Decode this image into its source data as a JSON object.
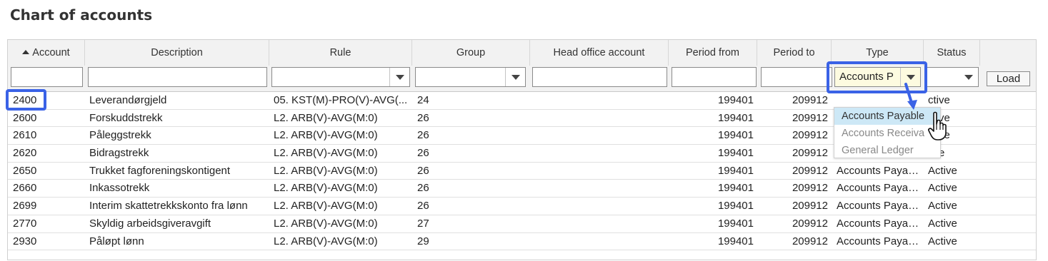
{
  "page": {
    "title": "Chart of accounts"
  },
  "columns": [
    {
      "key": "account",
      "label": "Account",
      "sorted": "asc"
    },
    {
      "key": "description",
      "label": "Description"
    },
    {
      "key": "rule",
      "label": "Rule"
    },
    {
      "key": "group",
      "label": "Group"
    },
    {
      "key": "head_office_account",
      "label": "Head office account"
    },
    {
      "key": "period_from",
      "label": "Period from"
    },
    {
      "key": "period_to",
      "label": "Period to"
    },
    {
      "key": "type",
      "label": "Type"
    },
    {
      "key": "status",
      "label": "Status"
    }
  ],
  "filters": {
    "account": "",
    "description": "",
    "rule": "",
    "group": "",
    "head_office_account": "",
    "period_from": "",
    "period_to": "",
    "type": "Accounts P",
    "status": "",
    "load_label": "Load"
  },
  "rows": [
    {
      "account": "2400",
      "description": "Leverandørgjeld",
      "rule": "05. KST(M)-PRO(V)-AVG(...",
      "group": "24",
      "period_from": "199401",
      "period_to": "209912",
      "type": "",
      "status": "ctive"
    },
    {
      "account": "2600",
      "description": "Forskuddstrekk",
      "rule": "L2. ARB(V)-AVG(M:0)",
      "group": "26",
      "period_from": "199401",
      "period_to": "209912",
      "type": "",
      "status": "ctive"
    },
    {
      "account": "2610",
      "description": "Påleggstrekk",
      "rule": "L2. ARB(V)-AVG(M:0)",
      "group": "26",
      "period_from": "199401",
      "period_to": "209912",
      "type": "",
      "status": "ctive"
    },
    {
      "account": "2620",
      "description": "Bidragstrekk",
      "rule": "L2. ARB(V)-AVG(M:0)",
      "group": "26",
      "period_from": "199401",
      "period_to": "209912",
      "type": "",
      "status": "tive"
    },
    {
      "account": "2650",
      "description": "Trukket fagforeningskontigent",
      "rule": "L2. ARB(V)-AVG(M:0)",
      "group": "26",
      "period_from": "199401",
      "period_to": "209912",
      "type": "Accounts Payable",
      "status": "Active"
    },
    {
      "account": "2660",
      "description": "Inkassotrekk",
      "rule": "L2. ARB(V)-AVG(M:0)",
      "group": "26",
      "period_from": "199401",
      "period_to": "209912",
      "type": "Accounts Payable",
      "status": "Active"
    },
    {
      "account": "2699",
      "description": "Interim skattetrekkskonto fra lønn",
      "rule": "L2. ARB(V)-AVG(M:0)",
      "group": "26",
      "period_from": "199401",
      "period_to": "209912",
      "type": "Accounts Payable",
      "status": "Active"
    },
    {
      "account": "2770",
      "description": "Skyldig arbeidsgiveravgift",
      "rule": "L2. ARB(V)-AVG(M:0)",
      "group": "27",
      "period_from": "199401",
      "period_to": "209912",
      "type": "Accounts Payable",
      "status": "Active"
    },
    {
      "account": "2930",
      "description": "Påløpt lønn",
      "rule": "L2. ARB(V)-AVG(M:0)",
      "group": "29",
      "period_from": "199401",
      "period_to": "209912",
      "type": "Accounts Payable",
      "status": "Active"
    }
  ],
  "type_dropdown": {
    "options": [
      "Accounts Payable",
      "Accounts Receiva",
      "General Ledger"
    ],
    "selected_index": 0
  },
  "colors": {
    "highlight": "#3a62e6",
    "header_bg": "#f2f2f2",
    "dropdown_selected": "#cde8f6"
  },
  "icons": {
    "sort": "sort-ascending-icon",
    "cursor": "hand-pointer-icon",
    "dropdown": "chevron-down-icon"
  }
}
